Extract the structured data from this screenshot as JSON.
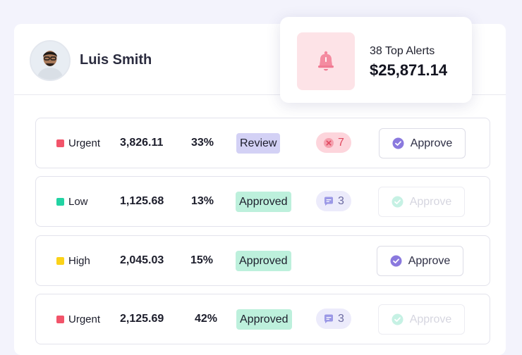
{
  "user": {
    "name": "Luis Smith"
  },
  "alert": {
    "title": "38 Top Alerts",
    "amount": "$25,871.14",
    "icon": "bell-icon"
  },
  "colors": {
    "urgent": "#f2546a",
    "low": "#22d3a3",
    "high": "#fbd219",
    "approve_check": "#8a79de",
    "approve_check_disabled": "#b8ede0"
  },
  "rows": [
    {
      "priority": "Urgent",
      "amount": "3,826.11",
      "percent": "33%",
      "status": "Review",
      "badge": "7",
      "badge_icon": "x-circle-icon",
      "action": "Approve",
      "action_enabled": true
    },
    {
      "priority": "Low",
      "amount": "1,125.68",
      "percent": "13%",
      "status": "Approved",
      "badge": "3",
      "badge_icon": "comment-icon",
      "action": "Approve",
      "action_enabled": false
    },
    {
      "priority": "High",
      "amount": "2,045.03",
      "percent": "15%",
      "status": "Approved",
      "badge": "",
      "badge_icon": "",
      "action": "Approve",
      "action_enabled": true
    },
    {
      "priority": "Urgent",
      "amount": "2,125.69",
      "percent": "42%",
      "status": "Approved",
      "badge": "3",
      "badge_icon": "comment-icon",
      "action": "Approve",
      "action_enabled": false
    }
  ]
}
